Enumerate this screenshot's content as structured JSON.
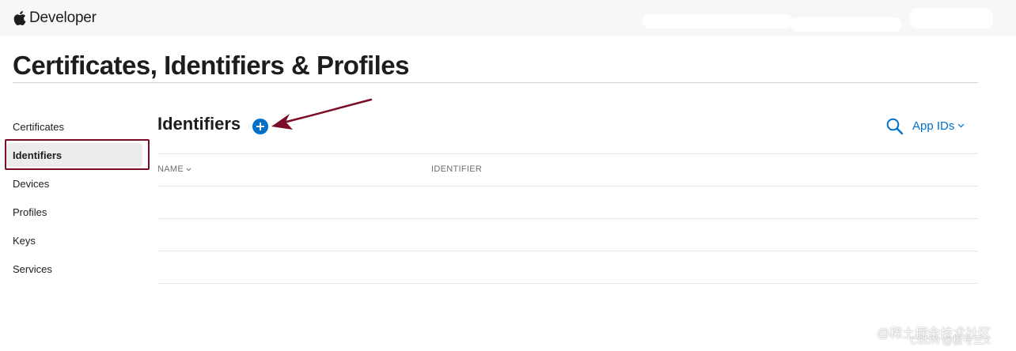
{
  "header": {
    "brand": "Developer"
  },
  "page": {
    "title": "Certificates, Identifiers & Profiles"
  },
  "sidebar": {
    "items": [
      {
        "label": "Certificates",
        "active": false
      },
      {
        "label": "Identifiers",
        "active": true
      },
      {
        "label": "Devices",
        "active": false
      },
      {
        "label": "Profiles",
        "active": false
      },
      {
        "label": "Keys",
        "active": false
      },
      {
        "label": "Services",
        "active": false
      }
    ]
  },
  "main": {
    "section_title": "Identifiers",
    "filter": {
      "selected": "App IDs"
    },
    "table": {
      "columns": [
        "NAME",
        "IDENTIFIER"
      ],
      "rows": [
        {
          "name": "-",
          "identifier": ""
        },
        {
          "name": "-",
          "identifier": "- -"
        },
        {
          "name": "-",
          "identifier": "-"
        }
      ]
    }
  },
  "watermark": {
    "line1": "@稀土掘金技术社区",
    "line2": "CSDN @根号三X"
  },
  "colors": {
    "accent": "#0070c9",
    "annotation": "#7a0c28",
    "rule": "#d2d2d7"
  }
}
